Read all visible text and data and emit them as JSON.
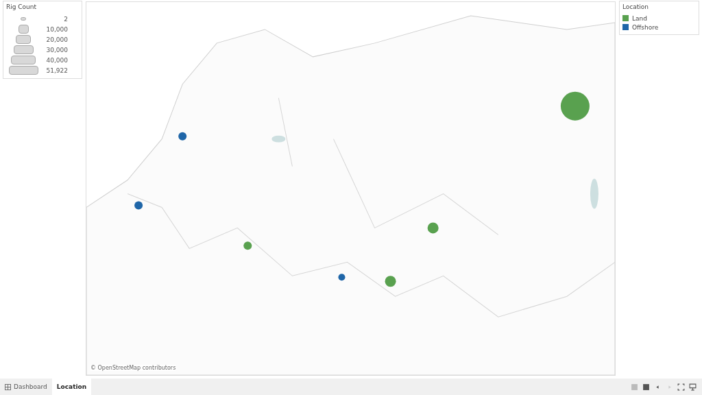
{
  "size_legend": {
    "title": "Rig Count",
    "items": [
      "2",
      "10,000",
      "20,000",
      "30,000",
      "40,000",
      "51,922"
    ]
  },
  "map": {
    "attribution": "© OpenStreetMap contributors"
  },
  "color_legend": {
    "title": "Location",
    "items": [
      {
        "label": "Land",
        "color": "#59a14f"
      },
      {
        "label": "Offshore",
        "color": "#1f66a8"
      }
    ]
  },
  "tabs": [
    {
      "label": "Dashboard",
      "selected": false,
      "kind": "dashboard"
    },
    {
      "label": "Location",
      "selected": true,
      "kind": "sheet"
    }
  ]
}
